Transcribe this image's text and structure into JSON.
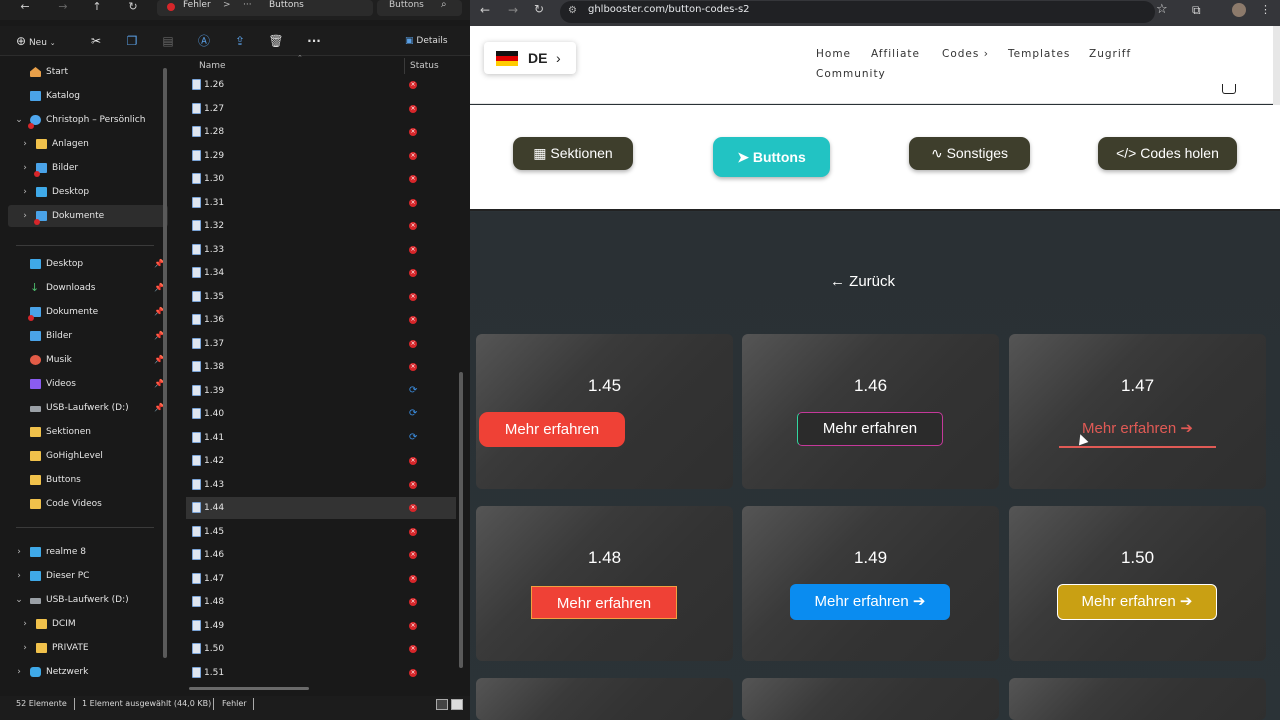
{
  "explorer": {
    "address": {
      "crumb1": "Fehler",
      "crumb2": "Buttons",
      "sep": ">",
      "more": "···"
    },
    "search": {
      "label": "Buttons"
    },
    "toolbar": {
      "new_label": "Neu",
      "details_label": "Details"
    },
    "nav": [
      {
        "label": "Start",
        "icon": "home-icon"
      },
      {
        "label": "Katalog",
        "icon": "gallery-icon"
      },
      {
        "label": "Christoph – Persönlich",
        "icon": "cloud-icon"
      },
      {
        "label": "Anlagen",
        "icon": "folder-icon"
      },
      {
        "label": "Bilder",
        "icon": "pictures-icon"
      },
      {
        "label": "Desktop",
        "icon": "desktop-icon"
      },
      {
        "label": "Dokumente",
        "icon": "documents-icon"
      },
      {
        "label": "Desktop",
        "icon": "desktop-icon"
      },
      {
        "label": "Downloads",
        "icon": "download-icon"
      },
      {
        "label": "Dokumente",
        "icon": "documents-icon"
      },
      {
        "label": "Bilder",
        "icon": "pictures-icon"
      },
      {
        "label": "Musik",
        "icon": "music-icon"
      },
      {
        "label": "Videos",
        "icon": "video-icon"
      },
      {
        "label": "USB-Laufwerk (D:)",
        "icon": "usb-drive-icon"
      },
      {
        "label": "Sektionen",
        "icon": "folder-icon"
      },
      {
        "label": "GoHighLevel",
        "icon": "folder-icon"
      },
      {
        "label": "Buttons",
        "icon": "folder-icon"
      },
      {
        "label": "Code Videos",
        "icon": "folder-icon"
      },
      {
        "label": "realme 8",
        "icon": "phone-icon"
      },
      {
        "label": "Dieser PC",
        "icon": "pc-icon"
      },
      {
        "label": "USB-Laufwerk (D:)",
        "icon": "usb-drive-icon"
      },
      {
        "label": "DCIM",
        "icon": "folder-icon"
      },
      {
        "label": "PRIVATE",
        "icon": "folder-icon"
      },
      {
        "label": "Netzwerk",
        "icon": "network-icon"
      }
    ],
    "columns": {
      "name": "Name",
      "status": "Status"
    },
    "files": [
      {
        "name": "1.26",
        "status": "error"
      },
      {
        "name": "1.27",
        "status": "error"
      },
      {
        "name": "1.28",
        "status": "error"
      },
      {
        "name": "1.29",
        "status": "error"
      },
      {
        "name": "1.30",
        "status": "error"
      },
      {
        "name": "1.31",
        "status": "error"
      },
      {
        "name": "1.32",
        "status": "error"
      },
      {
        "name": "1.33",
        "status": "error"
      },
      {
        "name": "1.34",
        "status": "error"
      },
      {
        "name": "1.35",
        "status": "error"
      },
      {
        "name": "1.36",
        "status": "error"
      },
      {
        "name": "1.37",
        "status": "error"
      },
      {
        "name": "1.38",
        "status": "error"
      },
      {
        "name": "1.39",
        "status": "syncing"
      },
      {
        "name": "1.40",
        "status": "syncing"
      },
      {
        "name": "1.41",
        "status": "syncing"
      },
      {
        "name": "1.42",
        "status": "error"
      },
      {
        "name": "1.43",
        "status": "error"
      },
      {
        "name": "1.44",
        "status": "error"
      },
      {
        "name": "1.45",
        "status": "error"
      },
      {
        "name": "1.46",
        "status": "error"
      },
      {
        "name": "1.47",
        "status": "error"
      },
      {
        "name": "1.48",
        "status": "error"
      },
      {
        "name": "1.49",
        "status": "error"
      },
      {
        "name": "1.50",
        "status": "error"
      },
      {
        "name": "1.51",
        "status": "error"
      }
    ],
    "selected_file": "1.44",
    "status": {
      "count": "52 Elemente",
      "selection": "1 Element ausgewählt (44,0 KB)",
      "state": "Fehler"
    }
  },
  "browser": {
    "url": "ghlbooster.com/button-codes-s2",
    "lang": "DE",
    "menu": [
      "Home",
      "Affiliate",
      "Codes ›",
      "Templates",
      "Zugriff",
      "Community"
    ],
    "categories": [
      {
        "label": "Sektionen",
        "icon": "grid-icon"
      },
      {
        "label": "Buttons",
        "icon": "pointer-icon"
      },
      {
        "label": "Sonstiges",
        "icon": "squiggle-icon"
      },
      {
        "label": "Codes holen",
        "icon": "code-icon"
      }
    ],
    "back_label": "Zurück",
    "back_icon": "←",
    "cards": [
      {
        "num": "1.45",
        "button": "Mehr erfahren"
      },
      {
        "num": "1.46",
        "button": "Mehr erfahren"
      },
      {
        "num": "1.47",
        "button": "Mehr erfahren",
        "arrow": "➔"
      },
      {
        "num": "1.48",
        "button": "Mehr erfahren"
      },
      {
        "num": "1.49",
        "button": "Mehr erfahren",
        "arrow": "➔"
      },
      {
        "num": "1.50",
        "button": "Mehr erfahren",
        "arrow": "➔"
      }
    ],
    "colors": {
      "teal": "#22c3c3",
      "olive": "#3e3e2c",
      "red": "#ef4136",
      "blue": "#0a8cf0",
      "gold": "#c9a013"
    }
  }
}
